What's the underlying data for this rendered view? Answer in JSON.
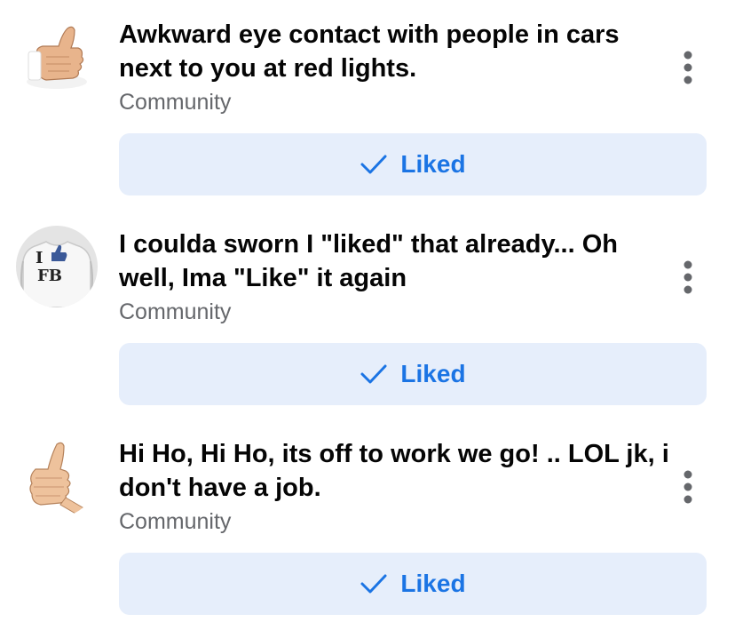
{
  "colors": {
    "accent": "#1b74e4",
    "button_bg": "#e6eefb",
    "subtitle": "#65676b",
    "title": "#050505"
  },
  "pages": [
    {
      "title": "Awkward eye contact with people in cars next to you at red lights.",
      "subtitle": "Community",
      "button_label": "Liked",
      "button_icon": "checkmark-icon",
      "avatar_icon": "thumbs-up-hand-icon"
    },
    {
      "title": "I coulda sworn I \"liked\" that already... Oh well, Ima \"Like\" it again",
      "subtitle": "Community",
      "button_label": "Liked",
      "button_icon": "checkmark-icon",
      "avatar_icon": "i-like-fb-shirt-icon",
      "avatar_text": {
        "line1": "I",
        "line2": "FB"
      }
    },
    {
      "title": "Hi Ho, Hi Ho, its off to work we go! .. LOL jk, i don't have a job.",
      "subtitle": "Community",
      "button_label": "Liked",
      "button_icon": "checkmark-icon",
      "avatar_icon": "thumbs-up-hand-icon"
    }
  ]
}
